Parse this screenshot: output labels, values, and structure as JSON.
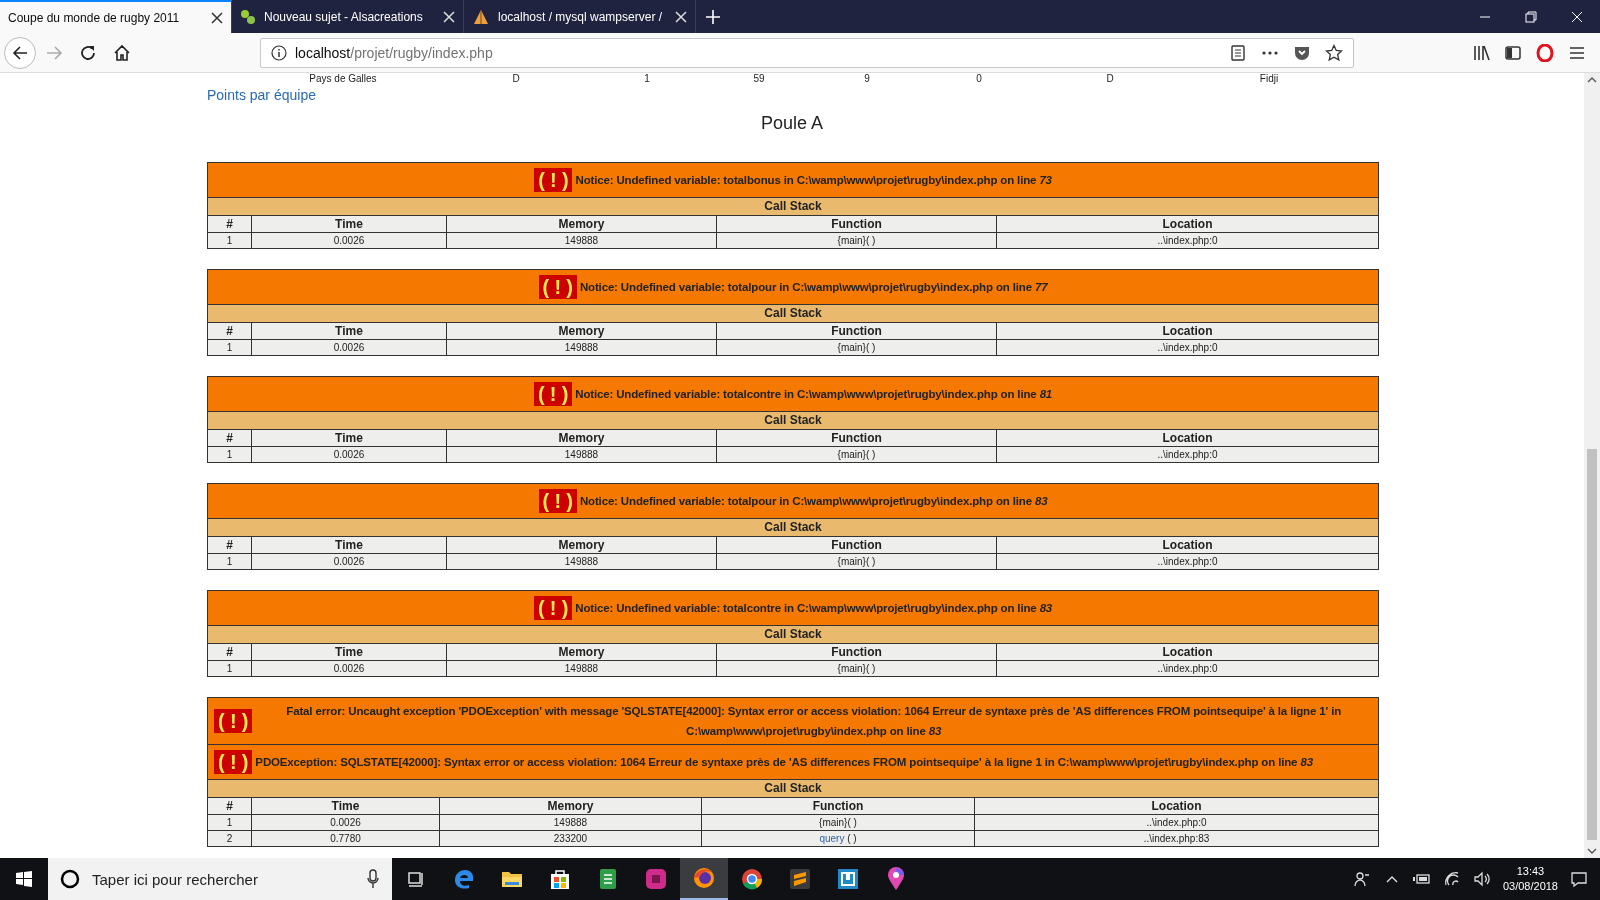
{
  "tabs": [
    {
      "title": "Coupe du monde de rugby 2011",
      "kind": "plain",
      "selected": true
    },
    {
      "title": "Nouveau sujet - Alsacreations",
      "kind": "leaf",
      "selected": false
    },
    {
      "title": "localhost / mysql wampserver /",
      "kind": "sail",
      "selected": false
    }
  ],
  "address_bar": {
    "host": "localhost",
    "path": "/projet/rugby/index.php"
  },
  "page": {
    "top_row": [
      "Pays de Galles",
      "D",
      "1",
      "59",
      "9",
      "0",
      "D",
      "Fidji"
    ],
    "link": "Points par équipe",
    "heading": "Poule A",
    "notices": [
      {
        "badge": "( ! )",
        "message": "Notice: Undefined variable: totalbonus in C:\\wamp\\www\\projet\\rugby\\index.php on line *73*",
        "stack": {
          "title": "Call Stack",
          "columns": [
            "#",
            "Time",
            "Memory",
            "Function",
            "Location"
          ],
          "rows": [
            {
              "n": "1",
              "time": "0.0026",
              "memory": "149888",
              "function": "{main}",
              "args": "( )",
              "linked": false,
              "location": "..\\index.php:0"
            }
          ]
        }
      },
      {
        "badge": "( ! )",
        "message": "Notice: Undefined variable: totalpour in C:\\wamp\\www\\projet\\rugby\\index.php on line *77*",
        "stack": {
          "title": "Call Stack",
          "columns": [
            "#",
            "Time",
            "Memory",
            "Function",
            "Location"
          ],
          "rows": [
            {
              "n": "1",
              "time": "0.0026",
              "memory": "149888",
              "function": "{main}",
              "args": "( )",
              "linked": false,
              "location": "..\\index.php:0"
            }
          ]
        }
      },
      {
        "badge": "( ! )",
        "message": "Notice: Undefined variable: totalcontre in C:\\wamp\\www\\projet\\rugby\\index.php on line *81*",
        "stack": {
          "title": "Call Stack",
          "columns": [
            "#",
            "Time",
            "Memory",
            "Function",
            "Location"
          ],
          "rows": [
            {
              "n": "1",
              "time": "0.0026",
              "memory": "149888",
              "function": "{main}",
              "args": "( )",
              "linked": false,
              "location": "..\\index.php:0"
            }
          ]
        }
      },
      {
        "badge": "( ! )",
        "message": "Notice: Undefined variable: totalpour in C:\\wamp\\www\\projet\\rugby\\index.php on line *83*",
        "stack": {
          "title": "Call Stack",
          "columns": [
            "#",
            "Time",
            "Memory",
            "Function",
            "Location"
          ],
          "rows": [
            {
              "n": "1",
              "time": "0.0026",
              "memory": "149888",
              "function": "{main}",
              "args": "( )",
              "linked": false,
              "location": "..\\index.php:0"
            }
          ]
        }
      },
      {
        "badge": "( ! )",
        "message": "Notice: Undefined variable: totalcontre in C:\\wamp\\www\\projet\\rugby\\index.php on line *83*",
        "stack": {
          "title": "Call Stack",
          "columns": [
            "#",
            "Time",
            "Memory",
            "Function",
            "Location"
          ],
          "rows": [
            {
              "n": "1",
              "time": "0.0026",
              "memory": "149888",
              "function": "{main}",
              "args": "( )",
              "linked": false,
              "location": "..\\index.php:0"
            }
          ]
        }
      }
    ],
    "fatal": {
      "messages": [
        {
          "badge": "( ! )",
          "message": "Fatal error: Uncaught exception 'PDOException' with message 'SQLSTATE[42000]: Syntax error or access violation: 1064 Erreur de syntaxe près de 'AS differences FROM pointsequipe' à la ligne 1' in C:\\wamp\\www\\projet\\rugby\\index.php on line *83*"
        },
        {
          "badge": "( ! )",
          "message": "PDOException: SQLSTATE[42000]: Syntax error or access violation: 1064 Erreur de syntaxe près de 'AS differences FROM pointsequipe' à la ligne 1 in C:\\wamp\\www\\projet\\rugby\\index.php on line *83*"
        }
      ],
      "stack": {
        "title": "Call Stack",
        "columns": [
          "#",
          "Time",
          "Memory",
          "Function",
          "Location"
        ],
        "rows": [
          {
            "n": "1",
            "time": "0.0026",
            "memory": "149888",
            "function": "{main}",
            "args": "( )",
            "linked": false,
            "location": "..\\index.php:0"
          },
          {
            "n": "2",
            "time": "0.7780",
            "memory": "233200",
            "function": "query",
            "args": " ( )",
            "linked": true,
            "location": "..\\index.php:83"
          }
        ]
      }
    }
  },
  "taskbar": {
    "search_placeholder": "Taper ici pour rechercher",
    "apps": [
      {
        "kind": "taskview",
        "selected": false
      },
      {
        "kind": "edge",
        "selected": false
      },
      {
        "kind": "folder",
        "selected": false
      },
      {
        "kind": "store",
        "selected": false
      },
      {
        "kind": "notes",
        "selected": false
      },
      {
        "kind": "pink",
        "selected": false
      },
      {
        "kind": "firefox",
        "selected": true
      },
      {
        "kind": "chrome",
        "selected": false
      },
      {
        "kind": "sublime",
        "selected": false
      },
      {
        "kind": "square",
        "selected": false
      },
      {
        "kind": "maps",
        "selected": false
      }
    ],
    "time": "13:43",
    "date": "03/08/2018"
  }
}
